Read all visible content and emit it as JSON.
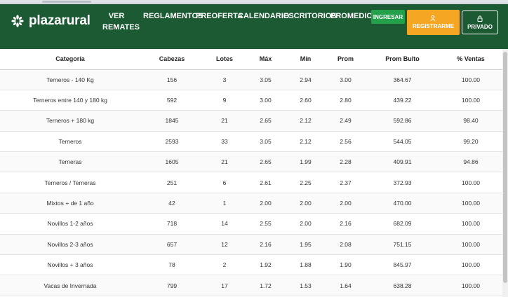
{
  "brand": {
    "logo_text": "plazarural"
  },
  "nav": {
    "links": [
      {
        "label": "VER REMATES"
      },
      {
        "label": "REGLAMENTOS"
      },
      {
        "label": "PREOFERTA"
      },
      {
        "label": "CALENDARIO"
      },
      {
        "label": "ESCRITORIOS"
      },
      {
        "label": "PROMEDIOS"
      }
    ],
    "ingresar": "INGRESAR",
    "registrarme": "REGISTRARME",
    "privado": "PRIVADO"
  },
  "colors": {
    "nav_bg": "#1c5a34",
    "ingresar_bg": "#23a04a",
    "registrarme_bg": "#f5a623"
  },
  "table": {
    "headers": [
      "Categoría",
      "Cabezas",
      "Lotes",
      "Máx",
      "Mín",
      "Prom",
      "Prom Bulto",
      "% Ventas"
    ],
    "rows": [
      [
        "Terneros - 140 Kg",
        "156",
        "3",
        "3.05",
        "2.94",
        "3.00",
        "364.67",
        "100.00"
      ],
      [
        "Terneros entre 140 y 180 kg",
        "592",
        "9",
        "3.00",
        "2.60",
        "2.80",
        "439.22",
        "100.00"
      ],
      [
        "Terneros + 180 kg",
        "1845",
        "21",
        "2.65",
        "2.12",
        "2.49",
        "592.86",
        "98.40"
      ],
      [
        "Terneros",
        "2593",
        "33",
        "3.05",
        "2.12",
        "2.56",
        "544.05",
        "99.20"
      ],
      [
        "Terneras",
        "1605",
        "21",
        "2.65",
        "1.99",
        "2.28",
        "409.91",
        "94.86"
      ],
      [
        "Terneros / Terneras",
        "251",
        "6",
        "2.61",
        "2.25",
        "2.37",
        "372.93",
        "100.00"
      ],
      [
        "Mixtos + de 1 año",
        "42",
        "1",
        "2.00",
        "2.00",
        "2.00",
        "470.00",
        "100.00"
      ],
      [
        "Novillos 1-2 años",
        "718",
        "14",
        "2.55",
        "2.00",
        "2.16",
        "682.09",
        "100.00"
      ],
      [
        "Novillos 2-3 años",
        "657",
        "12",
        "2.16",
        "1.95",
        "2.08",
        "751.15",
        "100.00"
      ],
      [
        "Novillos + 3 años",
        "78",
        "2",
        "1.92",
        "1.88",
        "1.90",
        "845.97",
        "100.00"
      ],
      [
        "Vacas de Invernada",
        "799",
        "17",
        "1.72",
        "1.53",
        "1.64",
        "638.28",
        "100.00"
      ]
    ]
  }
}
